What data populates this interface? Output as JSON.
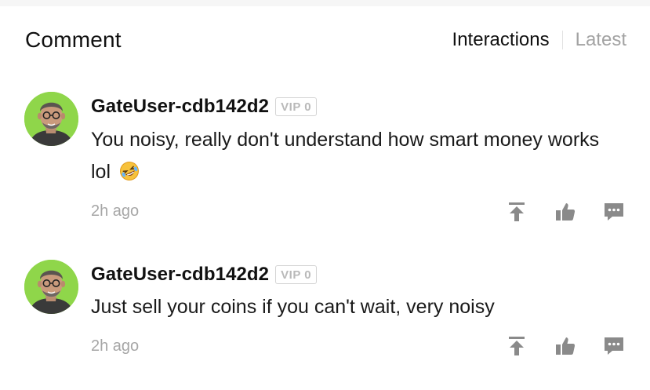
{
  "header": {
    "title": "Comment",
    "tabs": [
      {
        "label": "Interactions",
        "active": true
      },
      {
        "label": "Latest",
        "active": false
      }
    ]
  },
  "comments": [
    {
      "username": "GateUser-cdb142d2",
      "badge": "VIP 0",
      "text": "You noisy, really don't understand how smart money works lol",
      "emoji": "rolling-on-floor-laughing-emoji",
      "time": "2h ago",
      "actions": [
        "pin-icon",
        "thumbs-up-icon",
        "reply-icon"
      ]
    },
    {
      "username": "GateUser-cdb142d2",
      "badge": "VIP 0",
      "text": "Just sell your coins if you can't wait, very noisy",
      "time": "2h ago",
      "actions": [
        "pin-icon",
        "thumbs-up-icon",
        "reply-icon"
      ]
    }
  ],
  "colors": {
    "text_primary": "#111111",
    "text_muted": "#a6a6a6",
    "icon_gray": "#8a8a8a",
    "avatar_bg": "#8fd64a"
  }
}
